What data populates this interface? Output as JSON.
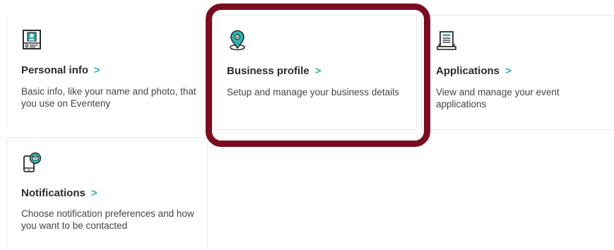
{
  "accent_color": "#2bb3b1",
  "highlight_color": "#7b0d20",
  "cards": [
    {
      "icon": "id-card-icon",
      "title": "Personal info",
      "chevron": ">",
      "description": "Basic info, like your name and photo, that you use on Eventeny"
    },
    {
      "icon": "location-pin-icon",
      "title": "Business profile",
      "chevron": ">",
      "description": "Setup and manage your business details"
    },
    {
      "icon": "application-form-icon",
      "title": "Applications",
      "chevron": ">",
      "description": "View and manage your event applications"
    },
    {
      "icon": "phone-message-icon",
      "title": "Notifications",
      "chevron": ">",
      "description": "Choose notification preferences and how you want to be contacted"
    }
  ]
}
